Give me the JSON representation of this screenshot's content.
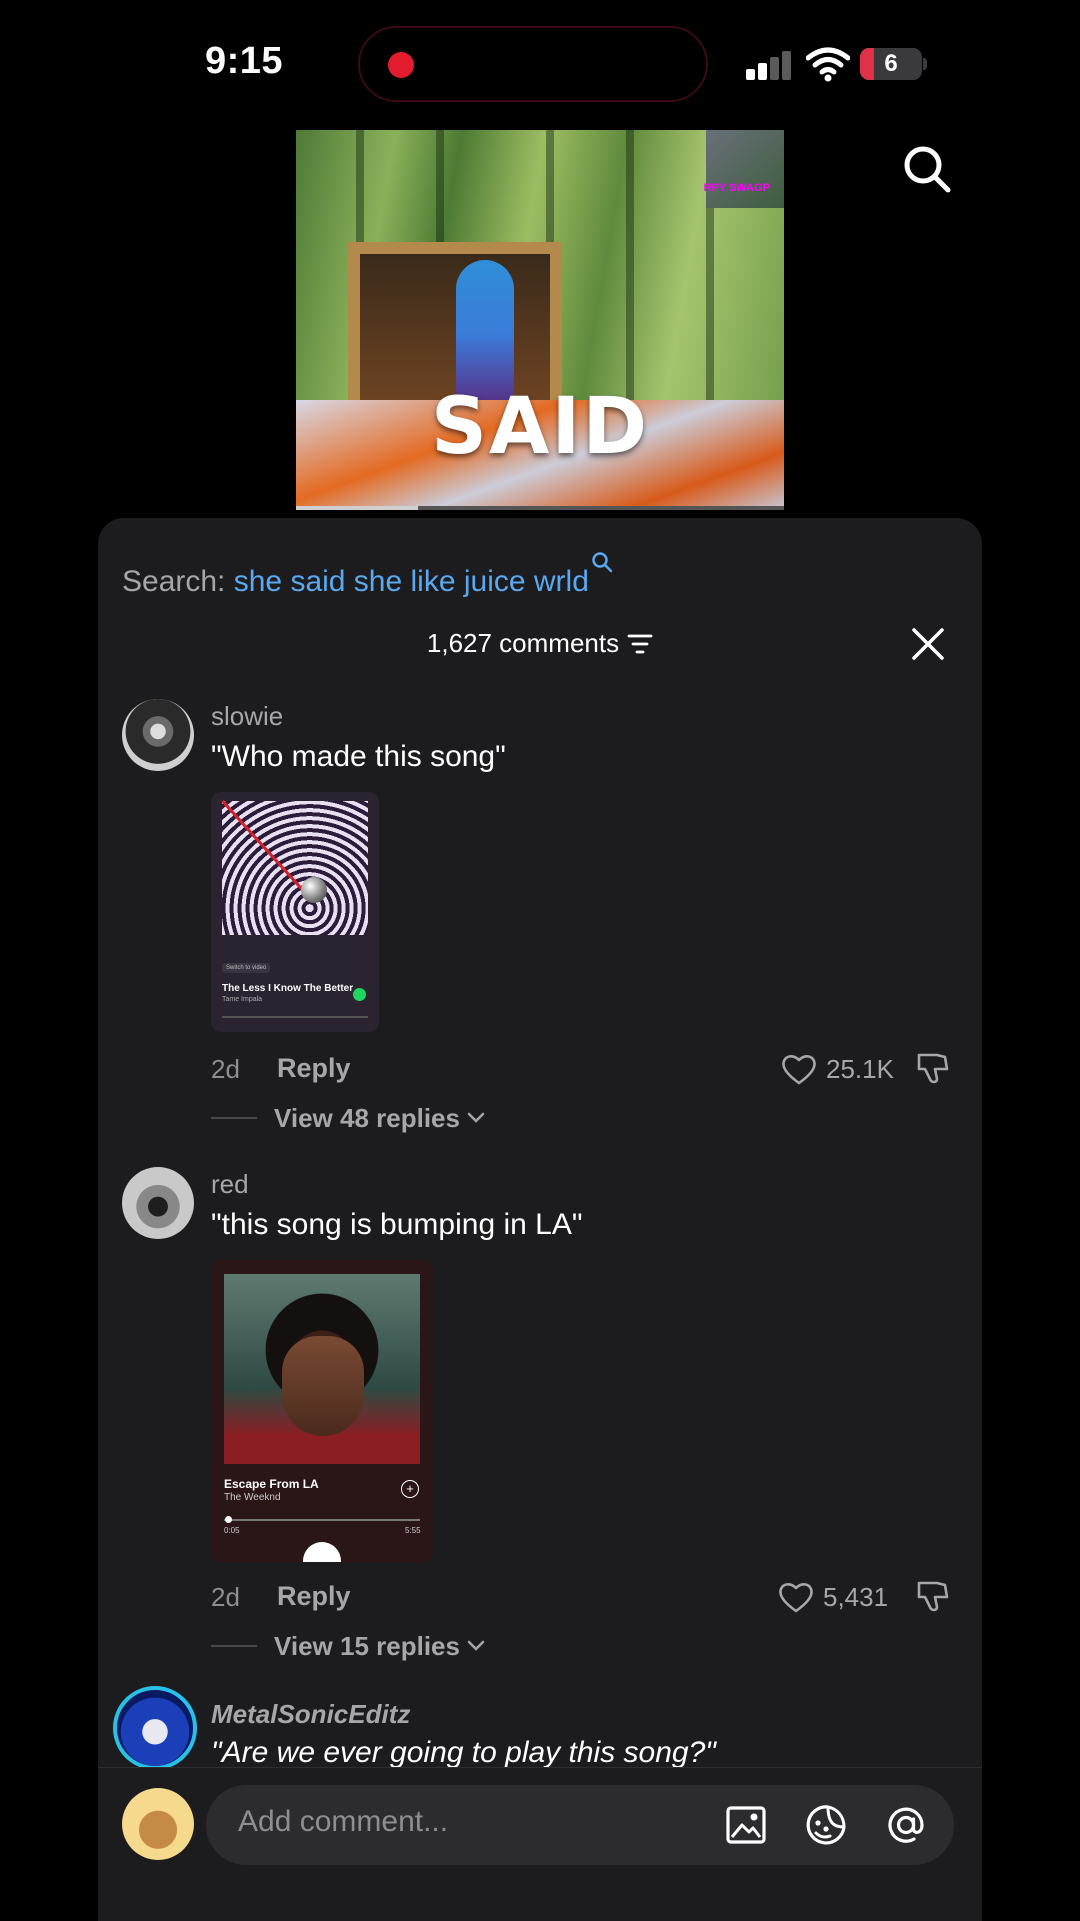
{
  "status_bar": {
    "time": "9:15",
    "battery": "6"
  },
  "video": {
    "caption": "SAID",
    "minimap_label": "RPY SWAGP"
  },
  "search": {
    "label": "Search:",
    "term": "she said she like juice wrld"
  },
  "comments_header": {
    "count_label": "1,627 comments"
  },
  "comments": [
    {
      "username": "slowie",
      "text": "\"Who made this song\"",
      "card": {
        "switch_label": "Switch to video",
        "title": "The Less I Know The Better",
        "artist": "Tame Impala"
      },
      "age": "2d",
      "reply_label": "Reply",
      "likes": "25.1K",
      "view_replies": "View 48 replies"
    },
    {
      "username": "red",
      "text": "\"this song is bumping in LA\"",
      "card": {
        "title": "Escape From LA",
        "artist": "The Weeknd",
        "time_elapsed": "0:05",
        "time_total": "5:55"
      },
      "age": "2d",
      "reply_label": "Reply",
      "likes": "5,431",
      "view_replies": "View 15 replies"
    },
    {
      "username": "MetalSonicEditz",
      "text": "\"Are we ever going to play this song?\""
    }
  ],
  "composer": {
    "placeholder": "Add comment..."
  },
  "colors": {
    "accent_link": "#5aa8ef",
    "sheet_bg": "#1c1c1e",
    "record_dot": "#e21b2d"
  },
  "icons": [
    "search-icon",
    "filter-icon",
    "close-icon",
    "heart-icon",
    "dislike-icon",
    "chevron-down-icon",
    "image-icon",
    "emoji-icon",
    "mention-icon"
  ]
}
